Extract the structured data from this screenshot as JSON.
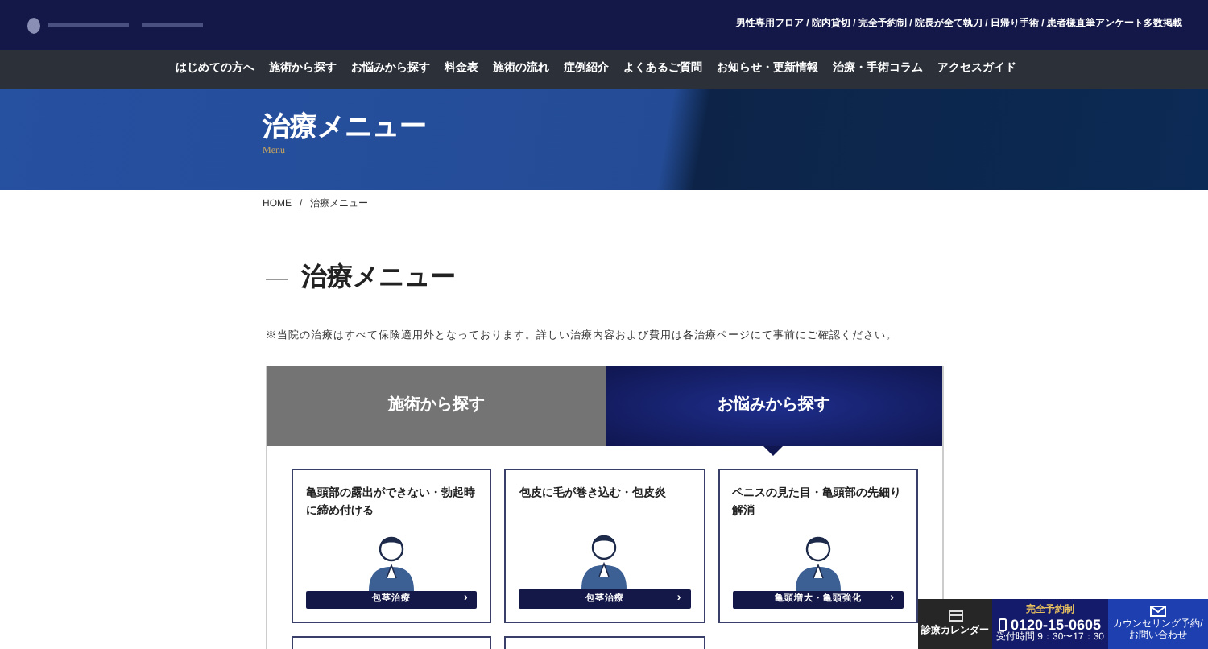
{
  "header": {
    "features": "男性専用フロア / 院内貸切 / 完全予約制 / 院長が全て執刀 / 日帰り手術 / 患者様直筆アンケート多数掲載"
  },
  "nav": [
    "はじめての方へ",
    "施術から探す",
    "お悩みから探す",
    "料金表",
    "施術の流れ",
    "症例紹介",
    "よくあるご質問",
    "お知らせ・更新情報",
    "治療・手術コラム",
    "アクセスガイド"
  ],
  "hero": {
    "title": "治療メニュー",
    "subtitle": "Menu"
  },
  "breadcrumb": [
    "HOME",
    "/",
    "治療メニュー"
  ],
  "heading": "治療メニュー",
  "note": "※当院の治療はすべて保険適用外となっております。詳しい治療内容および費用は各治療ページにて事前にご確認ください。",
  "tabs": [
    {
      "label": "施術から探す",
      "selected": false
    },
    {
      "label": "お悩みから探す",
      "selected": true
    }
  ],
  "cards": [
    {
      "title": "亀頭部の露出ができない・勃起時に締め付ける",
      "button": "包茎治療",
      "arrow": "›"
    },
    {
      "title": "包皮に毛が巻き込む・包皮炎",
      "button": "包茎治療",
      "arrow": "›"
    },
    {
      "title": "ペニスの見た目・亀頭部の先細り解消",
      "button": "亀頭増大・亀頭強化",
      "arrow": "›"
    }
  ],
  "footer_bar": {
    "calendar": "診療カレンダー",
    "reservation_note": "完全予約制",
    "phone": "0120-15-0605",
    "hours": "受付時間 9：30〜17：30",
    "contact": "カウンセリング予約/お問い合わせ"
  }
}
